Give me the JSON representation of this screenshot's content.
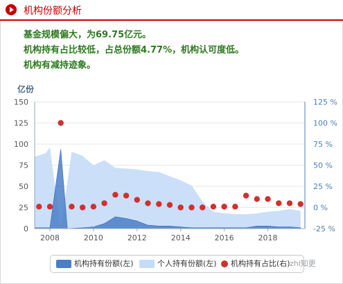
{
  "header": {
    "title": "机构份额分析"
  },
  "summary": {
    "line1": "基金规模偏大，为69.75亿元。",
    "line2": "机构持有占比较低，占总份额4.77%，机构认可度低。",
    "line3": "机构有减持迹象。"
  },
  "watermark": "zhi知更",
  "colors": {
    "institution": "#4a7fc8",
    "individual": "#c5dbf8",
    "ratio": "#d0302e",
    "accent": "#c40000",
    "summary_text": "#2d7a1f"
  },
  "chart_data": {
    "type": "area",
    "left_axis": {
      "unit": "亿份",
      "ticks": [
        "0",
        "25",
        "50",
        "75",
        "100",
        "125",
        "150"
      ],
      "range": [
        0,
        150
      ]
    },
    "right_axis": {
      "ticks": [
        "-25 %",
        "0 %",
        "25 %",
        "50 %",
        "75 %",
        "100 %",
        "125 %"
      ],
      "range": [
        -25,
        125
      ]
    },
    "x_ticks": [
      "2008",
      "2010",
      "2012",
      "2014",
      "2016",
      "2018"
    ],
    "x_range": [
      2007.3,
      2019.7
    ],
    "legend": [
      "机构持有份额(左)",
      "个人持有份额(左)",
      "机构持有占比(右)"
    ],
    "series": [
      {
        "name": "机构持有份额(左)",
        "kind": "area",
        "axis": "left",
        "points": [
          [
            2007.3,
            1
          ],
          [
            2008.0,
            1
          ],
          [
            2008.5,
            94
          ],
          [
            2008.8,
            0
          ],
          [
            2009.5,
            1
          ],
          [
            2010.0,
            2
          ],
          [
            2010.5,
            6
          ],
          [
            2011.0,
            14
          ],
          [
            2011.5,
            12
          ],
          [
            2012.0,
            9
          ],
          [
            2012.5,
            4
          ],
          [
            2013.0,
            3
          ],
          [
            2013.5,
            3
          ],
          [
            2014.0,
            2
          ],
          [
            2014.5,
            1
          ],
          [
            2015.0,
            1
          ],
          [
            2016.0,
            1
          ],
          [
            2017.0,
            1
          ],
          [
            2017.5,
            3
          ],
          [
            2018.0,
            3
          ],
          [
            2018.5,
            2
          ],
          [
            2019.0,
            2
          ],
          [
            2019.5,
            1
          ]
        ]
      },
      {
        "name": "个人持有份额(左)",
        "kind": "area",
        "axis": "left",
        "points": [
          [
            2007.3,
            85
          ],
          [
            2007.8,
            89
          ],
          [
            2008.0,
            96
          ],
          [
            2008.5,
            0
          ],
          [
            2009.0,
            91
          ],
          [
            2009.5,
            86
          ],
          [
            2010.0,
            75
          ],
          [
            2010.5,
            81
          ],
          [
            2011.0,
            72
          ],
          [
            2011.5,
            71
          ],
          [
            2012.0,
            70
          ],
          [
            2012.5,
            68
          ],
          [
            2013.0,
            67
          ],
          [
            2013.5,
            62
          ],
          [
            2014.0,
            57
          ],
          [
            2014.5,
            51
          ],
          [
            2015.0,
            32
          ],
          [
            2015.5,
            20
          ],
          [
            2016.0,
            18
          ],
          [
            2016.5,
            17
          ],
          [
            2017.0,
            17
          ],
          [
            2017.5,
            18
          ],
          [
            2018.0,
            20
          ],
          [
            2018.5,
            21
          ],
          [
            2019.0,
            23
          ],
          [
            2019.5,
            21
          ]
        ]
      },
      {
        "name": "机构持有占比(右)",
        "kind": "scatter",
        "axis": "right",
        "points": [
          [
            2007.5,
            1
          ],
          [
            2008.0,
            1
          ],
          [
            2008.5,
            100
          ],
          [
            2009.0,
            1
          ],
          [
            2009.5,
            0
          ],
          [
            2010.0,
            1
          ],
          [
            2010.5,
            5
          ],
          [
            2011.0,
            15
          ],
          [
            2011.5,
            14
          ],
          [
            2012.0,
            9
          ],
          [
            2012.5,
            5
          ],
          [
            2013.0,
            4
          ],
          [
            2013.5,
            3
          ],
          [
            2014.0,
            0
          ],
          [
            2014.5,
            0
          ],
          [
            2015.0,
            0
          ],
          [
            2015.5,
            1
          ],
          [
            2016.0,
            1
          ],
          [
            2016.5,
            1
          ],
          [
            2017.0,
            14
          ],
          [
            2017.5,
            10
          ],
          [
            2018.0,
            10
          ],
          [
            2018.5,
            5
          ],
          [
            2019.0,
            5
          ],
          [
            2019.5,
            4
          ]
        ]
      }
    ]
  }
}
